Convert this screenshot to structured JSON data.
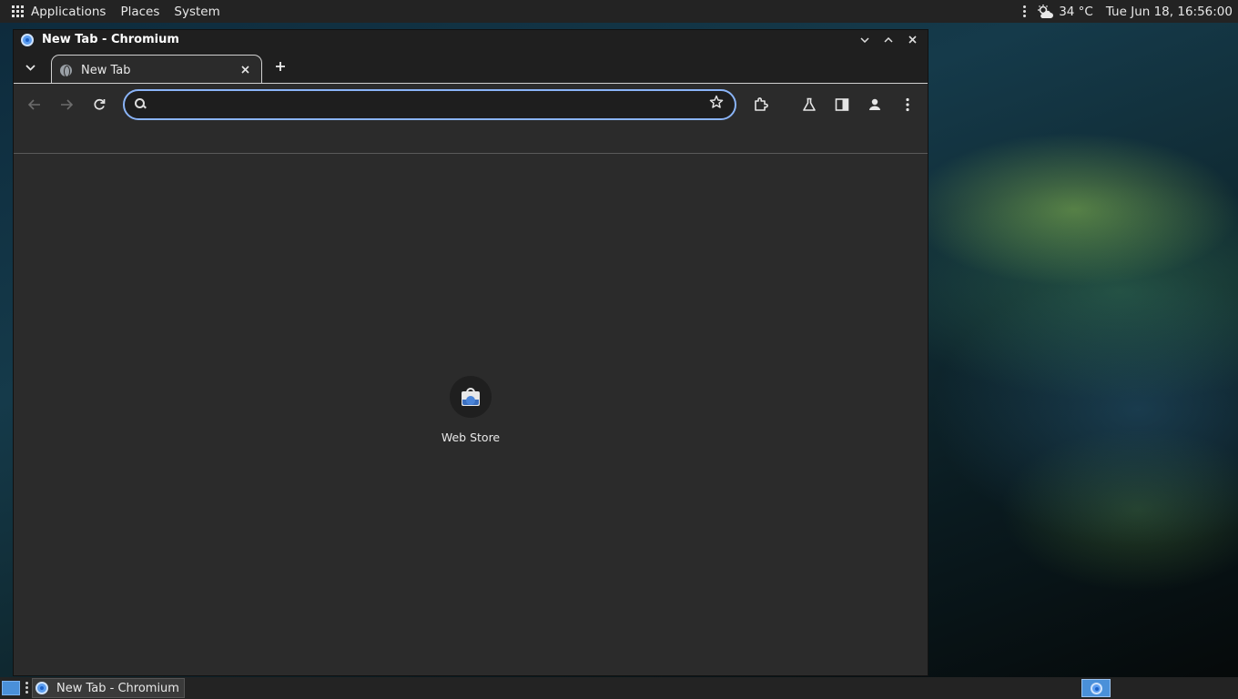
{
  "top_panel": {
    "menus": [
      "Applications",
      "Places",
      "System"
    ],
    "weather": "34 °C",
    "clock": "Tue Jun 18, 16:56:00"
  },
  "window": {
    "title": "New Tab - Chromium"
  },
  "tabs": [
    {
      "label": "New Tab",
      "active": true
    }
  ],
  "omnibox": {
    "value": "",
    "placeholder": ""
  },
  "new_tab_page": {
    "shortcuts": [
      {
        "label": "Web Store"
      }
    ]
  },
  "taskbar": {
    "tasks": [
      {
        "label": "New Tab - Chromium"
      }
    ]
  },
  "colors": {
    "accent": "#8ab4f8",
    "panel": "#232323",
    "page_bg": "#2b2b2b"
  }
}
